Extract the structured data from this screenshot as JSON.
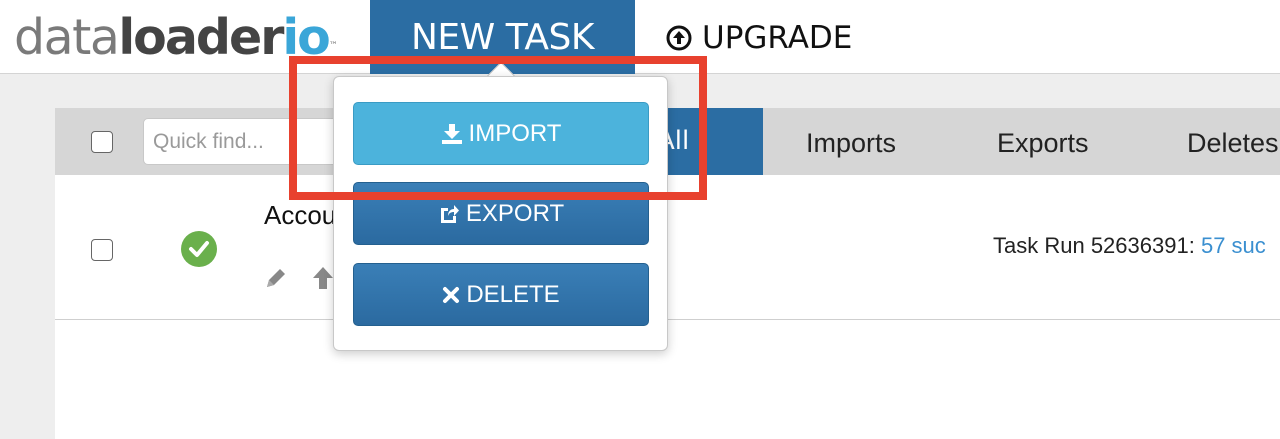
{
  "header": {
    "logo": {
      "part1": "data",
      "part2": "loader",
      "part3": "io",
      "tm": "™"
    },
    "new_task_label": "NEW TASK",
    "upgrade_label": "UPGRADE"
  },
  "toolbar": {
    "search_placeholder": "Quick find...",
    "tabs": [
      "All",
      "Imports",
      "Exports",
      "Deletes"
    ]
  },
  "task_row": {
    "name": "Accou",
    "status": "success",
    "last_run": {
      "prefix": "Task Run 52636391:",
      "link": "57 suc"
    }
  },
  "dropdown": {
    "items": [
      {
        "label": "IMPORT",
        "icon": "download-icon"
      },
      {
        "label": "EXPORT",
        "icon": "share-icon"
      },
      {
        "label": "DELETE",
        "icon": "close-icon"
      }
    ]
  },
  "colors": {
    "primary_blue": "#2b6da3",
    "import_blue": "#4cb3dc",
    "highlight_red": "#e8412e",
    "success_green": "#6ab04c",
    "link_blue": "#3a8fd0"
  }
}
